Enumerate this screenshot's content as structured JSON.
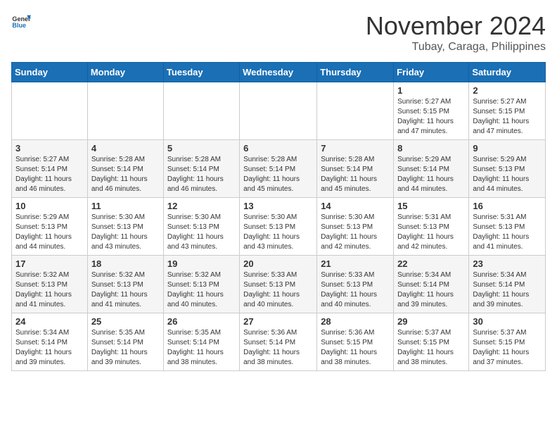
{
  "header": {
    "logo_line1": "General",
    "logo_line2": "Blue",
    "month": "November 2024",
    "location": "Tubay, Caraga, Philippines"
  },
  "days_of_week": [
    "Sunday",
    "Monday",
    "Tuesday",
    "Wednesday",
    "Thursday",
    "Friday",
    "Saturday"
  ],
  "weeks": [
    [
      {
        "day": "",
        "info": ""
      },
      {
        "day": "",
        "info": ""
      },
      {
        "day": "",
        "info": ""
      },
      {
        "day": "",
        "info": ""
      },
      {
        "day": "",
        "info": ""
      },
      {
        "day": "1",
        "info": "Sunrise: 5:27 AM\nSunset: 5:15 PM\nDaylight: 11 hours\nand 47 minutes."
      },
      {
        "day": "2",
        "info": "Sunrise: 5:27 AM\nSunset: 5:15 PM\nDaylight: 11 hours\nand 47 minutes."
      }
    ],
    [
      {
        "day": "3",
        "info": "Sunrise: 5:27 AM\nSunset: 5:14 PM\nDaylight: 11 hours\nand 46 minutes."
      },
      {
        "day": "4",
        "info": "Sunrise: 5:28 AM\nSunset: 5:14 PM\nDaylight: 11 hours\nand 46 minutes."
      },
      {
        "day": "5",
        "info": "Sunrise: 5:28 AM\nSunset: 5:14 PM\nDaylight: 11 hours\nand 46 minutes."
      },
      {
        "day": "6",
        "info": "Sunrise: 5:28 AM\nSunset: 5:14 PM\nDaylight: 11 hours\nand 45 minutes."
      },
      {
        "day": "7",
        "info": "Sunrise: 5:28 AM\nSunset: 5:14 PM\nDaylight: 11 hours\nand 45 minutes."
      },
      {
        "day": "8",
        "info": "Sunrise: 5:29 AM\nSunset: 5:14 PM\nDaylight: 11 hours\nand 44 minutes."
      },
      {
        "day": "9",
        "info": "Sunrise: 5:29 AM\nSunset: 5:13 PM\nDaylight: 11 hours\nand 44 minutes."
      }
    ],
    [
      {
        "day": "10",
        "info": "Sunrise: 5:29 AM\nSunset: 5:13 PM\nDaylight: 11 hours\nand 44 minutes."
      },
      {
        "day": "11",
        "info": "Sunrise: 5:30 AM\nSunset: 5:13 PM\nDaylight: 11 hours\nand 43 minutes."
      },
      {
        "day": "12",
        "info": "Sunrise: 5:30 AM\nSunset: 5:13 PM\nDaylight: 11 hours\nand 43 minutes."
      },
      {
        "day": "13",
        "info": "Sunrise: 5:30 AM\nSunset: 5:13 PM\nDaylight: 11 hours\nand 43 minutes."
      },
      {
        "day": "14",
        "info": "Sunrise: 5:30 AM\nSunset: 5:13 PM\nDaylight: 11 hours\nand 42 minutes."
      },
      {
        "day": "15",
        "info": "Sunrise: 5:31 AM\nSunset: 5:13 PM\nDaylight: 11 hours\nand 42 minutes."
      },
      {
        "day": "16",
        "info": "Sunrise: 5:31 AM\nSunset: 5:13 PM\nDaylight: 11 hours\nand 41 minutes."
      }
    ],
    [
      {
        "day": "17",
        "info": "Sunrise: 5:32 AM\nSunset: 5:13 PM\nDaylight: 11 hours\nand 41 minutes."
      },
      {
        "day": "18",
        "info": "Sunrise: 5:32 AM\nSunset: 5:13 PM\nDaylight: 11 hours\nand 41 minutes."
      },
      {
        "day": "19",
        "info": "Sunrise: 5:32 AM\nSunset: 5:13 PM\nDaylight: 11 hours\nand 40 minutes."
      },
      {
        "day": "20",
        "info": "Sunrise: 5:33 AM\nSunset: 5:13 PM\nDaylight: 11 hours\nand 40 minutes."
      },
      {
        "day": "21",
        "info": "Sunrise: 5:33 AM\nSunset: 5:13 PM\nDaylight: 11 hours\nand 40 minutes."
      },
      {
        "day": "22",
        "info": "Sunrise: 5:34 AM\nSunset: 5:14 PM\nDaylight: 11 hours\nand 39 minutes."
      },
      {
        "day": "23",
        "info": "Sunrise: 5:34 AM\nSunset: 5:14 PM\nDaylight: 11 hours\nand 39 minutes."
      }
    ],
    [
      {
        "day": "24",
        "info": "Sunrise: 5:34 AM\nSunset: 5:14 PM\nDaylight: 11 hours\nand 39 minutes."
      },
      {
        "day": "25",
        "info": "Sunrise: 5:35 AM\nSunset: 5:14 PM\nDaylight: 11 hours\nand 39 minutes."
      },
      {
        "day": "26",
        "info": "Sunrise: 5:35 AM\nSunset: 5:14 PM\nDaylight: 11 hours\nand 38 minutes."
      },
      {
        "day": "27",
        "info": "Sunrise: 5:36 AM\nSunset: 5:14 PM\nDaylight: 11 hours\nand 38 minutes."
      },
      {
        "day": "28",
        "info": "Sunrise: 5:36 AM\nSunset: 5:15 PM\nDaylight: 11 hours\nand 38 minutes."
      },
      {
        "day": "29",
        "info": "Sunrise: 5:37 AM\nSunset: 5:15 PM\nDaylight: 11 hours\nand 38 minutes."
      },
      {
        "day": "30",
        "info": "Sunrise: 5:37 AM\nSunset: 5:15 PM\nDaylight: 11 hours\nand 37 minutes."
      }
    ]
  ]
}
